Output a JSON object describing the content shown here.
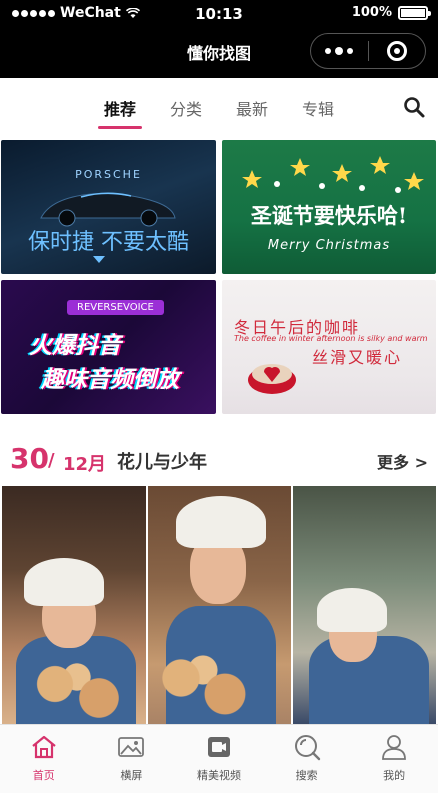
{
  "status_bar": {
    "carrier": "WeChat",
    "time": "10:13",
    "battery": "100%"
  },
  "title_bar": {
    "title": "懂你找图"
  },
  "tabs": {
    "items": [
      {
        "label": "推荐",
        "active": true
      },
      {
        "label": "分类",
        "active": false
      },
      {
        "label": "最新",
        "active": false
      },
      {
        "label": "专辑",
        "active": false
      }
    ],
    "search_icon": "search-icon"
  },
  "banners": [
    {
      "brand": "PORSCHE",
      "caption": "保时捷 不要太酷"
    },
    {
      "caption": "圣诞节要快乐哈!",
      "subcaption": "Merry Christmas"
    },
    {
      "tag": "REVERSEVOICE",
      "line1": "火爆抖音",
      "line2": "趣味音频倒放"
    },
    {
      "line1": "冬日午后的咖啡",
      "english": "The coffee in winter afternoon is silky and warm",
      "line2": "丝滑又暖心"
    }
  ],
  "section": {
    "day": "30",
    "slash": "/",
    "month": "12月",
    "title": "花儿与少年",
    "more": "更多 >"
  },
  "tabbar": {
    "items": [
      {
        "label": "首页",
        "icon": "home-icon",
        "active": true
      },
      {
        "label": "横屏",
        "icon": "image-icon",
        "active": false
      },
      {
        "label": "精美视频",
        "icon": "video-icon",
        "active": false
      },
      {
        "label": "搜索",
        "icon": "search-icon",
        "active": false
      },
      {
        "label": "我的",
        "icon": "user-icon",
        "active": false
      }
    ]
  },
  "colors": {
    "accent": "#d6336c",
    "header_bg": "#000000"
  }
}
